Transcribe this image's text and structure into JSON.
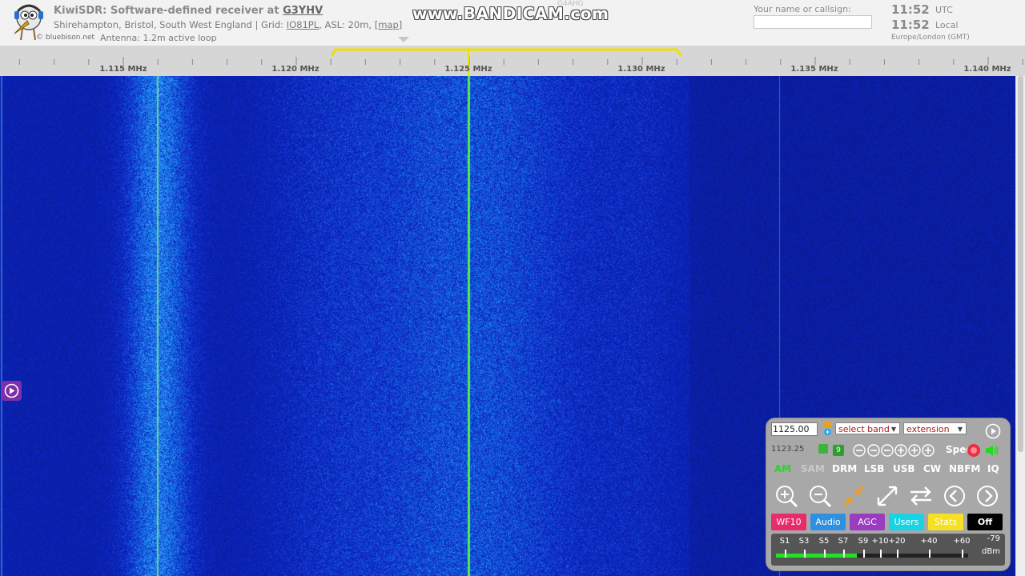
{
  "header": {
    "title_prefix": "KiwiSDR: Software-defined receiver at ",
    "title_call": "G3YHV",
    "location_text": "Shirehampton, Bristol, South West England | Grid: ",
    "grid": "IO81PL",
    "location_text2": ", ASL: 20m, [",
    "map_link": "map",
    "location_text3": "]",
    "antenna": "Antenna: 1.2m active loop",
    "logo_credit": "© bluebison.net",
    "watermark": "www.BANDICAM.com",
    "faint_call": "G4AHG",
    "ident_label": "Your name or callsign:",
    "ident_placeholder": "",
    "clock_utc": "11:52",
    "clock_utc_suffix": "UTC",
    "clock_local": "11:52",
    "clock_local_suffix": "Local",
    "timezone": "Europe/London (GMT)"
  },
  "scale": {
    "labels": [
      "1.115 MHz",
      "1.120 MHz",
      "1.125 MHz",
      "1.130 MHz",
      "1.135 MHz",
      "1.140 MHz"
    ]
  },
  "panel": {
    "freq_value": "1125.00",
    "band_select": "select band",
    "extension_select": "extension",
    "freq_readout": "1123.25",
    "step_number": "9",
    "spec_label": "Spec",
    "modes": [
      "AM",
      "SAM",
      "DRM",
      "LSB",
      "USB",
      "CW",
      "NBFM",
      "IQ"
    ],
    "active_mode": "AM",
    "tabs": [
      {
        "label": "WF10",
        "color": "#e82c6a"
      },
      {
        "label": "Audio",
        "color": "#2f8fe0"
      },
      {
        "label": "AGC",
        "color": "#9a3cbf"
      },
      {
        "label": "Users",
        "color": "#19d2e6"
      },
      {
        "label": "Stats",
        "color": "#f5e022"
      },
      {
        "label": "Off",
        "color": "#000000"
      }
    ],
    "smeter": {
      "labels": [
        "S1",
        "S3",
        "S5",
        "S7",
        "S9",
        "+10",
        "+20",
        "+40",
        "+60"
      ],
      "dbm_value": "-79",
      "dbm_unit": "dBm",
      "level": 0.42
    }
  },
  "colors": {
    "waterfall_bg": "#0a1a9a",
    "carrier": "#4ef04e",
    "passband": "#f0e000",
    "panel_bg": "#a8a8a8"
  }
}
